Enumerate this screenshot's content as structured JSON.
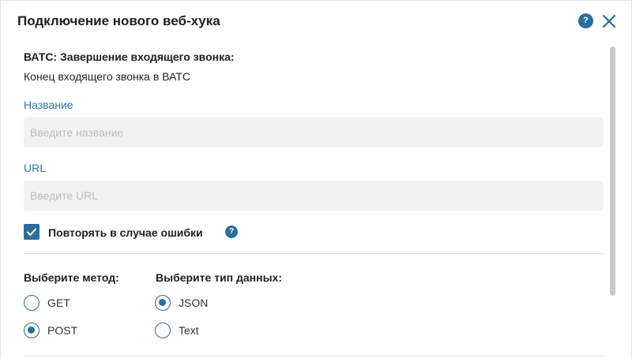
{
  "dialog": {
    "title": "Подключение нового веб-хука",
    "help_icon_text": "?"
  },
  "event": {
    "title": "ВАТС: Завершение входящего звонка:",
    "description": "Конец входящего звонка в ВАТС"
  },
  "name_field": {
    "label": "Название",
    "placeholder": "Введите название",
    "value": ""
  },
  "url_field": {
    "label": "URL",
    "placeholder": "Введите URL",
    "value": ""
  },
  "retry": {
    "label": "Повторять в случае ошибки",
    "checked": true,
    "help_icon_text": "?"
  },
  "method": {
    "title": "Выберите метод:",
    "options": [
      {
        "label": "GET",
        "selected": false
      },
      {
        "label": "POST",
        "selected": true
      }
    ]
  },
  "data_type": {
    "title": "Выберите тип данных:",
    "options": [
      {
        "label": "JSON",
        "selected": true
      },
      {
        "label": "Text",
        "selected": false
      }
    ]
  },
  "colors": {
    "accent": "#2c6d99",
    "label_blue": "#2f75a8",
    "input_bg": "#f2f2f2"
  }
}
